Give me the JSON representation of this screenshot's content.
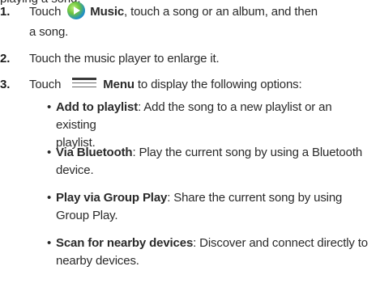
{
  "top_fragment": "playing a song.",
  "steps": [
    {
      "number": "1.",
      "pre": "Touch",
      "icon": "music-app-icon",
      "app_label": "Music",
      "post": ", touch a song or an album, and then",
      "line2": "a song."
    },
    {
      "number": "2.",
      "text": "Touch the music player to enlarge it."
    },
    {
      "number": "3.",
      "pre": "Touch",
      "icon": "menu-icon",
      "menu_label": "Menu",
      "post": " to display the following options:"
    }
  ],
  "options": [
    {
      "title": "Add to playlist",
      "line1": ": Add the song to a new playlist or an existing",
      "line2": "playlist."
    },
    {
      "title": "Via Bluetooth",
      "line1": ": Play the current song by using a Bluetooth",
      "line2": "device."
    },
    {
      "title": "Play via Group Play",
      "line1": ": Share the current song by using",
      "line2": "Group Play."
    },
    {
      "title": "Scan for nearby devices",
      "line1": ": Discover and connect directly to",
      "line2": "nearby devices."
    }
  ],
  "bullet_char": "•"
}
